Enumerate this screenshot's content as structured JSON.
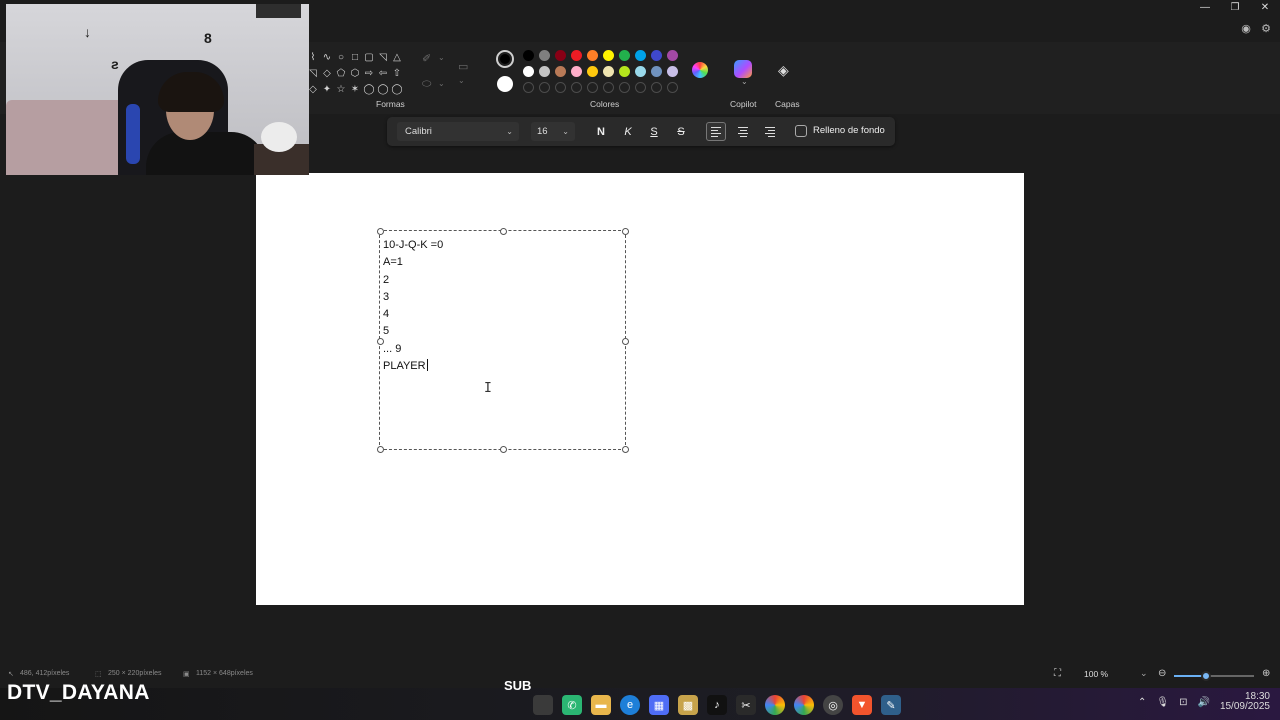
{
  "window": {
    "minimize": "—",
    "restore": "❐",
    "close": "✕"
  },
  "ribbon": {
    "shapes_label": "Formas",
    "colors_label": "Colores",
    "copilot_label": "Copilot",
    "layers_label": "Capas",
    "shapes": [
      "⌇",
      "∿",
      "○",
      "□",
      "▢",
      "◹",
      "△",
      "◹",
      "◇",
      "⬠",
      "⬡",
      "⇨",
      "⇦",
      "⇧",
      "◇",
      "✦",
      "☆",
      "✶",
      "◯",
      "◯",
      "◯"
    ],
    "selected_color_1": "#000000",
    "selected_color_2": "#ffffff",
    "palette_row1": [
      "#000000",
      "#7f7f7f",
      "#880015",
      "#ed1c24",
      "#ff7f27",
      "#fff200",
      "#22b14c",
      "#00a2e8",
      "#3f48cc",
      "#a349a4"
    ],
    "palette_row2": [
      "#ffffff",
      "#c3c3c3",
      "#b97a57",
      "#ffaec9",
      "#ffc90e",
      "#efe4b0",
      "#b5e61d",
      "#99d9ea",
      "#7092be",
      "#c8bfe7"
    ],
    "palette_empty_count": 10
  },
  "text_toolbar": {
    "font": "Calibri",
    "size": "16",
    "bold": "N",
    "italic": "K",
    "underline": "S",
    "strike": "S",
    "background_fill_label": "Relleno de fondo"
  },
  "canvas": {
    "text_lines": [
      "10-J-Q-K =0",
      "A=1",
      "2",
      "3",
      "4",
      "5",
      "... 9",
      "PLAYER"
    ]
  },
  "status": {
    "cursor_pos": "486, 412píxeles",
    "selection_size": "250 × 220píxeles",
    "canvas_size": "1152 × 648píxeles",
    "zoom": "100 %",
    "zoom_level_percent": 40
  },
  "overlay": {
    "streamer_name": "DTV_DAYANA",
    "sub_label": "SUB"
  },
  "taskbar": {
    "time": "18:30",
    "date": "15/09/2025"
  }
}
